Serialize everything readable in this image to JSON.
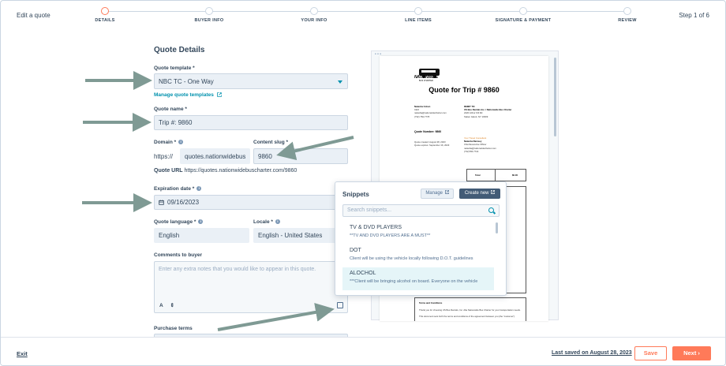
{
  "header": {
    "title": "Edit a quote",
    "step_indicator": "Step 1 of 6",
    "steps": [
      {
        "label": "DETAILS"
      },
      {
        "label": "BUYER INFO"
      },
      {
        "label": "YOUR INFO"
      },
      {
        "label": "LINE ITEMS"
      },
      {
        "label": "SIGNATURE & PAYMENT"
      },
      {
        "label": "REVIEW"
      }
    ]
  },
  "form": {
    "section_title": "Quote Details",
    "template_label": "Quote template *",
    "template_value": "NBC TC - One Way",
    "manage_templates": "Manage quote templates",
    "name_label": "Quote name *",
    "name_value": "Trip #: 9860",
    "domain_label": "Domain *",
    "domain_prefix": "https://",
    "domain_value": "quotes.nationwidebus",
    "slug_label": "Content slug *",
    "slug_value": "9860",
    "url_label": "Quote URL",
    "url_value": "https://quotes.nationwidebuscharter.com/9860",
    "expiration_label": "Expiration date *",
    "expiration_value": "09/16/2023",
    "language_label": "Quote language *",
    "language_value": "English",
    "locale_label": "Locale *",
    "locale_value": "English - United States",
    "comments_label": "Comments to buyer",
    "comments_placeholder": "Enter any extra notes that you would like to appear in this quote.",
    "purchase_terms_label": "Purchase terms"
  },
  "preview": {
    "logo_text": "NATIONWIDE",
    "logo_sub": "BUS CHARTER",
    "title": "Quote for Trip # 9860",
    "from_name": "Natasha Cohen",
    "from_lines": [
      "CEO",
      "natasha@nationwidecharter.com",
      "(732) 784-7778"
    ],
    "remit_label": "REMIT TO:",
    "remit_lines": [
      "US Bus Rentals Inc. / Nationwide Bus Charter",
      "2420 Arthur Kill Rd",
      "Staten Island, NY 10309"
    ],
    "quote_number": "Quote Number: 9860",
    "created": "Quote created: August 28, 2023",
    "expires": "Quote expires: September 16, 2023",
    "consultant_label": "Your Travel Consultant",
    "consultant_name": "Natasha Ramsey",
    "consultant_lines": [
      "Chief Executive Officer",
      "natasha@nationwidecharter.com",
      "(732)784-7722"
    ],
    "total_label": "Total",
    "total_value": "$0.00",
    "terms_label": "Terms and Conditions",
    "terms_lines": [
      "Thank you for choosing US Bus Rentals, Inc. dba Nationwide Bus Charter for your transportation needs.",
      "This document sets forth the terms and conditions of the agreement between you (the \"customer\")"
    ]
  },
  "snippets": {
    "title": "Snippets",
    "manage_label": "Manage",
    "create_label": "Create new",
    "search_placeholder": "Search snippets...",
    "items": [
      {
        "title": "TV & DVD PLAYERS",
        "desc": "**TV AND DVD PLAYERS ARE A MUST**"
      },
      {
        "title": "DOT",
        "desc": "Client will be using the vehicle locally following D.O.T. guidelines"
      },
      {
        "title": "ALOCHOL",
        "desc": "***Client will be bringing alcohol on board. Everyone on the vehicle"
      }
    ]
  },
  "toolbar": {
    "bold_glyph": "A",
    "more_glyph": "⇕"
  },
  "footer": {
    "exit_label": "Exit",
    "saved_label": "Last saved on August 28, 2023",
    "save_label": "Save",
    "next_label": "Next ›"
  },
  "colors": {
    "accent": "#ff7a59",
    "link": "#0091ae",
    "text": "#33475b",
    "field_bg": "#eaf0f6",
    "arrow": "#7f9a94"
  },
  "icons": [
    "external-link-icon",
    "calendar-icon",
    "info-icon",
    "search-icon",
    "snippet-icon",
    "chevron-down-icon"
  ]
}
